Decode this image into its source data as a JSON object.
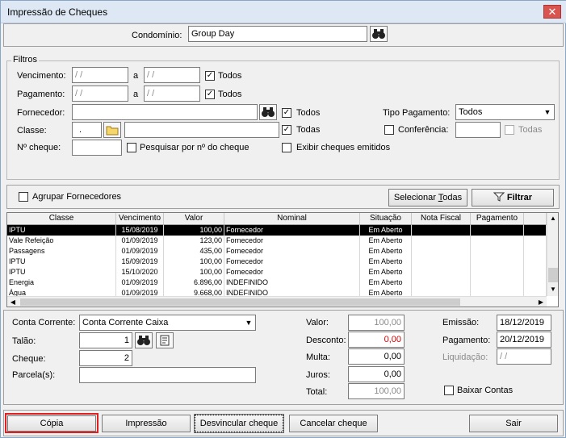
{
  "window": {
    "title": "Impressão de Cheques",
    "close": "✕"
  },
  "condominio": {
    "label": "Condomínio:",
    "value": "Group Day"
  },
  "filtros": {
    "legend": "Filtros",
    "vencimento": {
      "label": "Vencimento:",
      "from": " / /",
      "sep": "a",
      "to": " / /",
      "todos": "Todos",
      "checked": "✓"
    },
    "pagamento": {
      "label": "Pagamento:",
      "from": " / /",
      "sep": "a",
      "to": " / /",
      "todos": "Todos",
      "checked": "✓"
    },
    "fornecedor": {
      "label": "Fornecedor:",
      "value": "",
      "todos": "Todos",
      "checked": "✓"
    },
    "classe": {
      "label": "Classe:",
      "code": ".",
      "value": "",
      "todas": "Todas",
      "checked": "✓"
    },
    "cheque": {
      "label": "Nº cheque:",
      "value": "",
      "pesquisar": "Pesquisar por nº do cheque"
    },
    "exibir": "Exibir cheques emitidos",
    "tipo_pagamento": {
      "label": "Tipo Pagamento:",
      "value": "Todos"
    },
    "conferencia": {
      "label": "Conferência:",
      "value": "",
      "todas": "Todas"
    }
  },
  "agrupar": "Agrupar Fornecedores",
  "selecionar_todas": {
    "pre": "Selecionar ",
    "u": "T",
    "post": "odas"
  },
  "filtrar": "Filtrar",
  "grid": {
    "columns": [
      "Classe",
      "Vencimento",
      "Valor",
      "Nominal",
      "Situação",
      "Nota Fiscal",
      "Pagamento"
    ],
    "rows": [
      [
        "IPTU",
        "15/08/2019",
        "100,00",
        "Fornecedor",
        "Em Aberto",
        "",
        ""
      ],
      [
        "Vale Refeição",
        "01/09/2019",
        "123,00",
        "Fornecedor",
        "Em Aberto",
        "",
        ""
      ],
      [
        "Passagens",
        "01/09/2019",
        "435,00",
        "Fornecedor",
        "Em Aberto",
        "",
        ""
      ],
      [
        "IPTU",
        "15/09/2019",
        "100,00",
        "Fornecedor",
        "Em Aberto",
        "",
        ""
      ],
      [
        "IPTU",
        "15/10/2020",
        "100,00",
        "Fornecedor",
        "Em Aberto",
        "",
        ""
      ],
      [
        "Energia",
        "01/09/2019",
        "6.896,00",
        "INDEFINIDO",
        "Em Aberto",
        "",
        ""
      ],
      [
        "Água",
        "01/09/2019",
        "9.668,00",
        "INDEFINIDO",
        "Em Aberto",
        "",
        ""
      ]
    ]
  },
  "bottom": {
    "conta": {
      "label": "Conta Corrente:",
      "value": "Conta Corrente Caixa"
    },
    "talao": {
      "label": "Talão:",
      "value": "1"
    },
    "cheque": {
      "label": "Cheque:",
      "value": "2"
    },
    "parcela": {
      "label": "Parcela(s):",
      "value": ""
    },
    "valor": {
      "label": "Valor:",
      "value": "100,00"
    },
    "desconto": {
      "label": "Desconto:",
      "value": "0,00"
    },
    "multa": {
      "label": "Multa:",
      "value": "0,00"
    },
    "juros": {
      "label": "Juros:",
      "value": "0,00"
    },
    "total": {
      "label": "Total:",
      "value": "100,00"
    },
    "emissao": {
      "label": "Emissão:",
      "value": "18/12/2019"
    },
    "pagamento": {
      "label": "Pagamento:",
      "value": "20/12/2019"
    },
    "liquidacao": {
      "label": "Liquidação:",
      "value": " / /"
    },
    "baixar": "Baixar Contas"
  },
  "buttons": {
    "copia": "Cópia",
    "impressao": "Impressão",
    "desvincular": "Desvincular cheque",
    "cancelar": "Cancelar cheque",
    "sair": "Sair"
  },
  "colors": {
    "highlight": "#e02020",
    "title_bg": "#dde8f4",
    "selected_row": "#000000"
  }
}
